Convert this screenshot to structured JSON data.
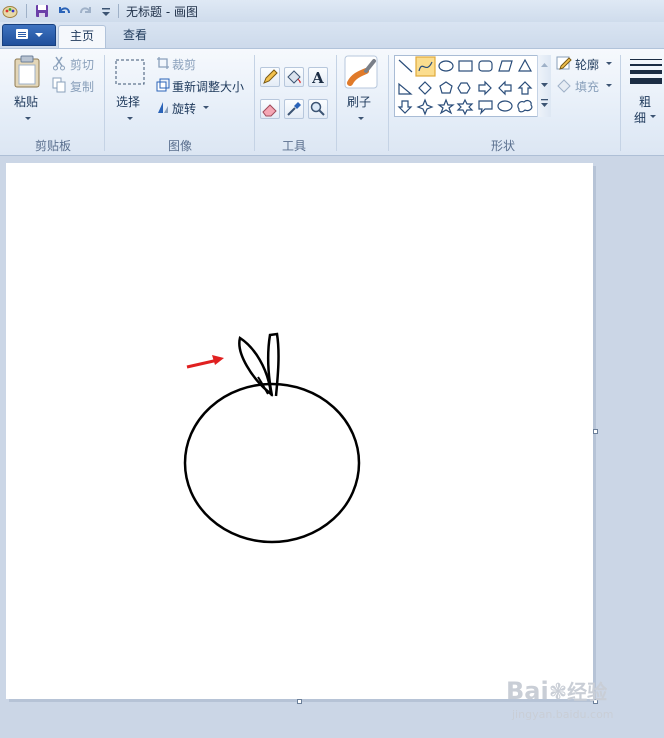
{
  "window": {
    "title": "无标题 - 画图"
  },
  "quick_access": {
    "icons": [
      "paint-app-icon",
      "save-icon",
      "undo-icon",
      "redo-icon",
      "customize-dropdown-icon"
    ]
  },
  "tabs": [
    {
      "label": "主页",
      "active": true
    },
    {
      "label": "查看",
      "active": false
    }
  ],
  "ribbon": {
    "clipboard": {
      "paste_label": "粘贴",
      "cut_label": "剪切",
      "copy_label": "复制",
      "group_label": "剪贴板"
    },
    "image": {
      "select_label": "选择",
      "crop_label": "裁剪",
      "resize_label": "重新调整大小",
      "rotate_label": "旋转",
      "group_label": "图像"
    },
    "tools": {
      "items": [
        "pencil-icon",
        "fill-icon",
        "text-icon",
        "eraser-icon",
        "color-picker-icon",
        "magnifier-icon"
      ],
      "group_label": "工具"
    },
    "brushes": {
      "label": "刷子"
    },
    "shapes": {
      "group_label": "形状",
      "selected": "curve",
      "outline_label": "轮廓",
      "fill_label": "填充"
    },
    "size": {
      "label_line1": "粗",
      "label_line2": "细"
    }
  },
  "colors": {
    "arrow": "#e02020",
    "stroke": "#000000",
    "canvas": "#ffffff",
    "selected_shape_bg": "#fbdd8e"
  },
  "watermark": {
    "brand": "Bai",
    "brand_suffix": "经验",
    "url": "jingyan.baidu.com"
  }
}
